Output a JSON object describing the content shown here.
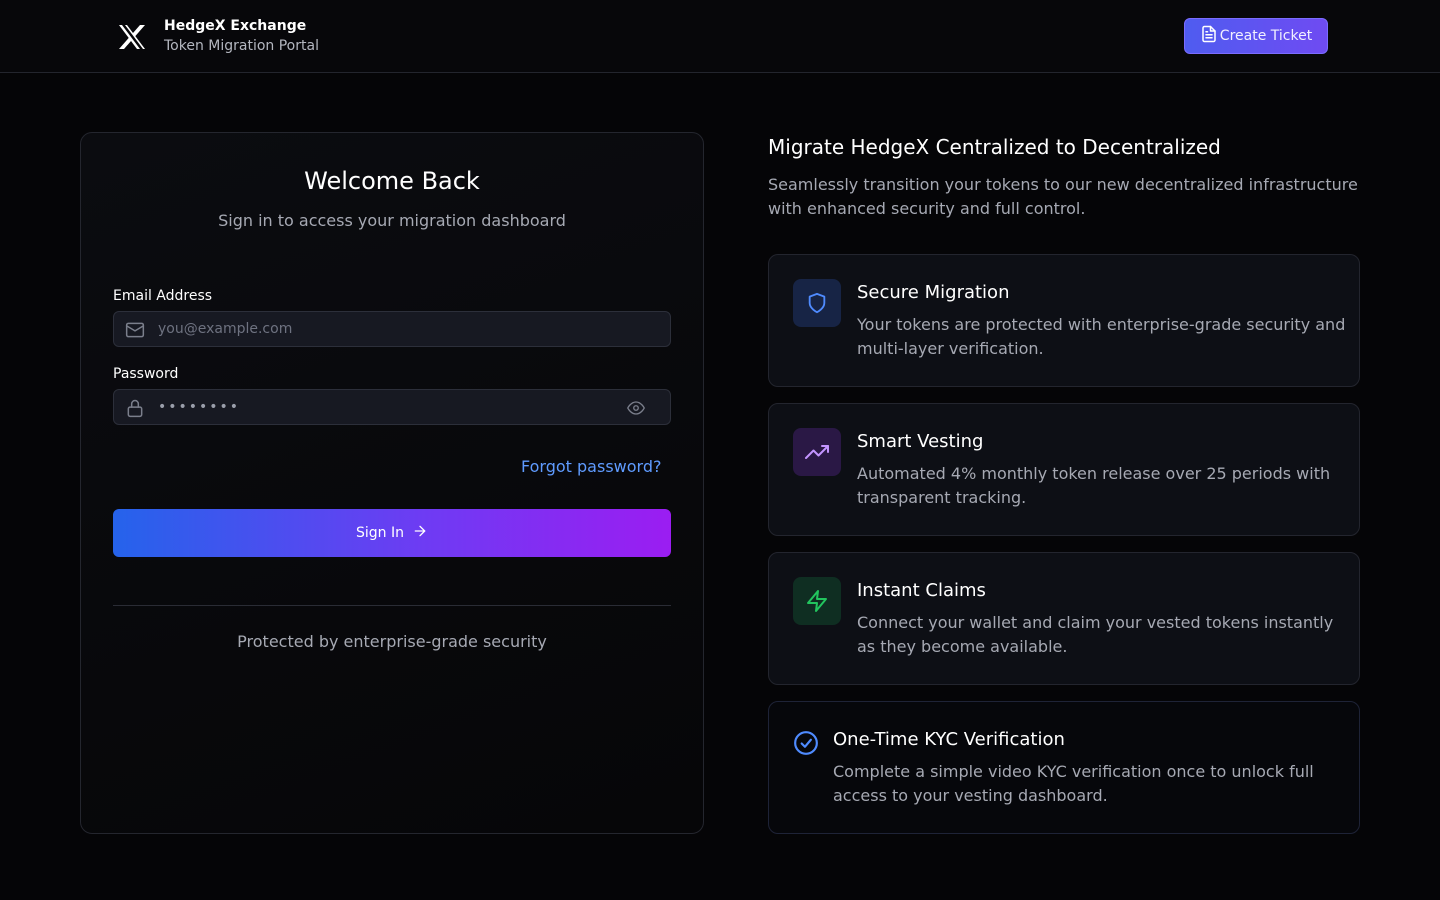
{
  "header": {
    "logo_letter": "X",
    "brand_name": "HedgeX Exchange",
    "brand_subtitle": "Token Migration Portal",
    "create_ticket_label": "Create Ticket",
    "create_ticket_icon": "file-text-icon"
  },
  "login": {
    "title": "Welcome Back",
    "subtitle": "Sign in to access your migration dashboard",
    "email_label": "Email Address",
    "email_placeholder": "you@example.com",
    "email_icon": "mail-icon",
    "password_label": "Password",
    "password_value": "••••••••",
    "password_icon": "lock-icon",
    "show_password_icon": "eye-icon",
    "forgot_label": "Forgot password?",
    "signin_label": "Sign In",
    "signin_icon": "arrow-right-icon",
    "security_note": " Protected by enterprise-grade security"
  },
  "info": {
    "title": "Migrate HedgeX Centralized to Decentralized",
    "description": "Seamlessly transition your tokens to our new decentralized infrastructure with enhanced security and full control.",
    "features": [
      {
        "title": "Secure Migration",
        "description": "Your tokens are protected with enterprise-grade security and multi-layer verification.",
        "icon": "shield-icon",
        "color": "#4f8bff"
      },
      {
        "title": "Smart Vesting",
        "description": "Automated 4% monthly token release over 25 periods with transparent tracking.",
        "icon": "trending-up-icon",
        "color": "#b57bff"
      },
      {
        "title": "Instant Claims",
        "description": "Connect your wallet and claim your vested tokens instantly as they become available.",
        "icon": "zap-icon",
        "color": "#22c55e"
      },
      {
        "title": "One-Time KYC Verification",
        "description": "Complete a simple video KYC verification once to unlock full access to your vesting dashboard.",
        "icon": "check-circle-icon",
        "color": "#4f8bff"
      }
    ]
  },
  "colors": {
    "background": "#050507",
    "accent_blue": "#2563eb",
    "accent_purple": "#9b1df2",
    "link": "#5f9bff"
  }
}
